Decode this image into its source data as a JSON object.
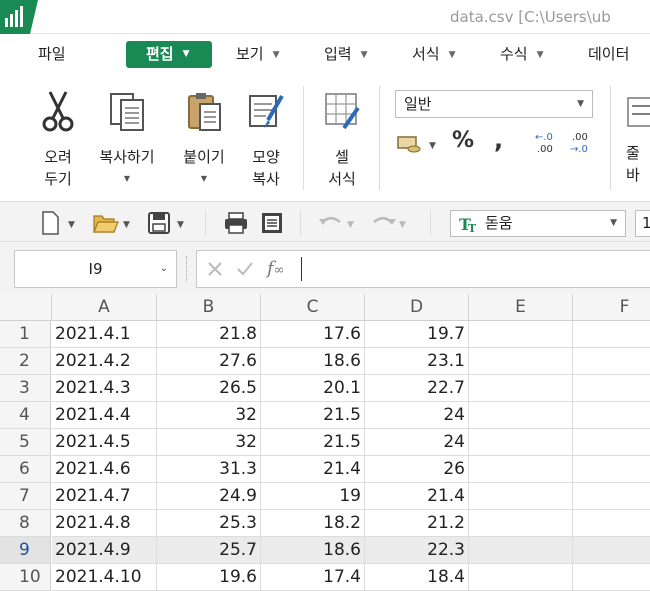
{
  "window": {
    "title": "data.csv  [C:\\Users\\ub"
  },
  "menu": {
    "items": [
      {
        "label": "파일",
        "active": false
      },
      {
        "label": "편집",
        "active": true
      },
      {
        "label": "보기",
        "active": false
      },
      {
        "label": "입력",
        "active": false
      },
      {
        "label": "서식",
        "active": false
      },
      {
        "label": "수식",
        "active": false
      },
      {
        "label": "데이터",
        "active": false
      }
    ]
  },
  "ribbon": {
    "cut": {
      "line1": "오려",
      "line2": "두기"
    },
    "copy": {
      "line1": "복사하기"
    },
    "paste": {
      "line1": "붙이기"
    },
    "format_copy": {
      "line1": "모양",
      "line2": "복사"
    },
    "cell_format": {
      "line1": "셀",
      "line2": "서식"
    },
    "number_format": "일반",
    "percent_symbol": "%",
    "comma_symbol": ",",
    "inc_decimal": "←.0\n.00",
    "dec_decimal": ".00\n→.0",
    "wrap_partial": {
      "line1": "줄",
      "line2": "바"
    }
  },
  "toolbar": {
    "font_name": "돋움",
    "font_size": "1"
  },
  "formula": {
    "name_box": "I9",
    "fx_label": "fx",
    "value": ""
  },
  "sheet": {
    "columns": [
      "A",
      "B",
      "C",
      "D",
      "E",
      "F"
    ],
    "selected_row": 9,
    "rows": [
      {
        "n": "1",
        "a": "2021.4.1",
        "b": "21.8",
        "c": "17.6",
        "d": "19.7"
      },
      {
        "n": "2",
        "a": "2021.4.2",
        "b": "27.6",
        "c": "18.6",
        "d": "23.1"
      },
      {
        "n": "3",
        "a": "2021.4.3",
        "b": "26.5",
        "c": "20.1",
        "d": "22.7"
      },
      {
        "n": "4",
        "a": "2021.4.4",
        "b": "32",
        "c": "21.5",
        "d": "24"
      },
      {
        "n": "5",
        "a": "2021.4.5",
        "b": "32",
        "c": "21.5",
        "d": "24"
      },
      {
        "n": "6",
        "a": "2021.4.6",
        "b": "31.3",
        "c": "21.4",
        "d": "26"
      },
      {
        "n": "7",
        "a": "2021.4.7",
        "b": "24.9",
        "c": "19",
        "d": "21.4"
      },
      {
        "n": "8",
        "a": "2021.4.8",
        "b": "25.3",
        "c": "18.2",
        "d": "21.2"
      },
      {
        "n": "9",
        "a": "2021.4.9",
        "b": "25.7",
        "c": "18.6",
        "d": "22.3"
      },
      {
        "n": "10",
        "a": "2021.4.10",
        "b": "19.6",
        "c": "17.4",
        "d": "18.4"
      }
    ]
  },
  "colors": {
    "accent": "#1a8a55",
    "selected_row_number": "#1e4fa0"
  }
}
